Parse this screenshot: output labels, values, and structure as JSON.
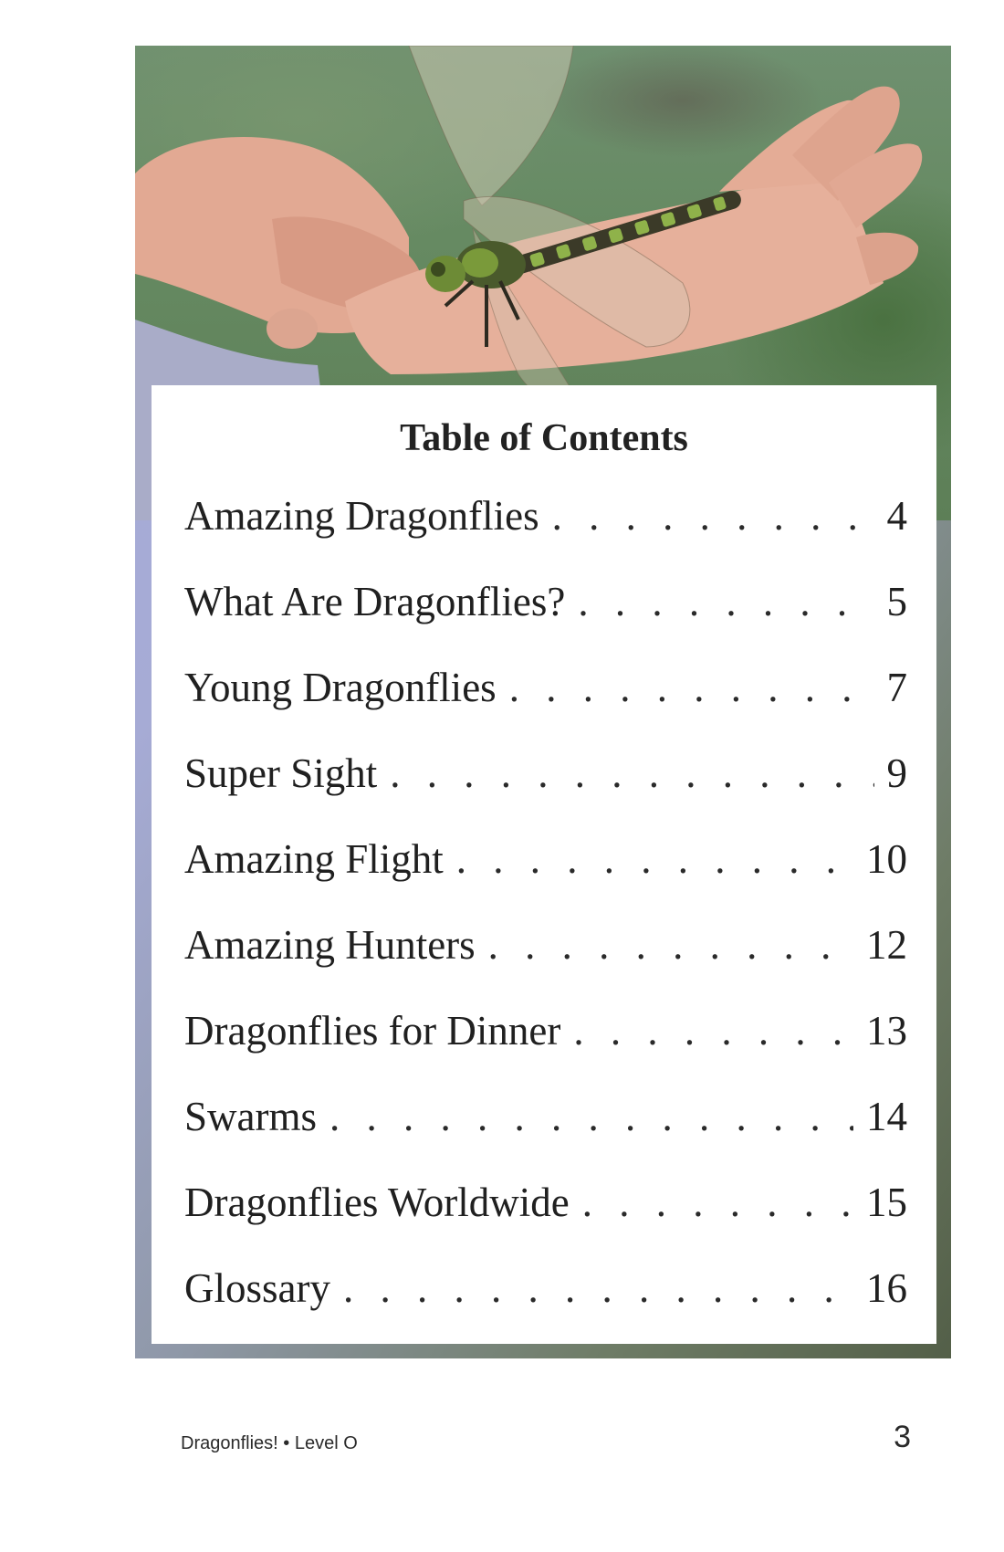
{
  "toc": {
    "title": "Table of Contents",
    "entries": [
      {
        "label": "Amazing Dragonflies",
        "page": "4"
      },
      {
        "label": "What Are Dragonflies?",
        "page": "5"
      },
      {
        "label": "Young Dragonflies",
        "page": "7"
      },
      {
        "label": "Super Sight",
        "page": "9"
      },
      {
        "label": "Amazing Flight",
        "page": "10"
      },
      {
        "label": "Amazing Hunters",
        "page": "12"
      },
      {
        "label": "Dragonflies for Dinner",
        "page": "13"
      },
      {
        "label": "Swarms",
        "page": "14"
      },
      {
        "label": "Dragonflies Worldwide",
        "page": "15"
      },
      {
        "label": "Glossary",
        "page": "16"
      }
    ]
  },
  "footer": {
    "book_title": "Dragonflies! • Level O",
    "page_number": "3"
  },
  "colors": {
    "frame_lavender": "#a7acd9",
    "frame_green": "#535f48",
    "panel": "#ffffff"
  }
}
